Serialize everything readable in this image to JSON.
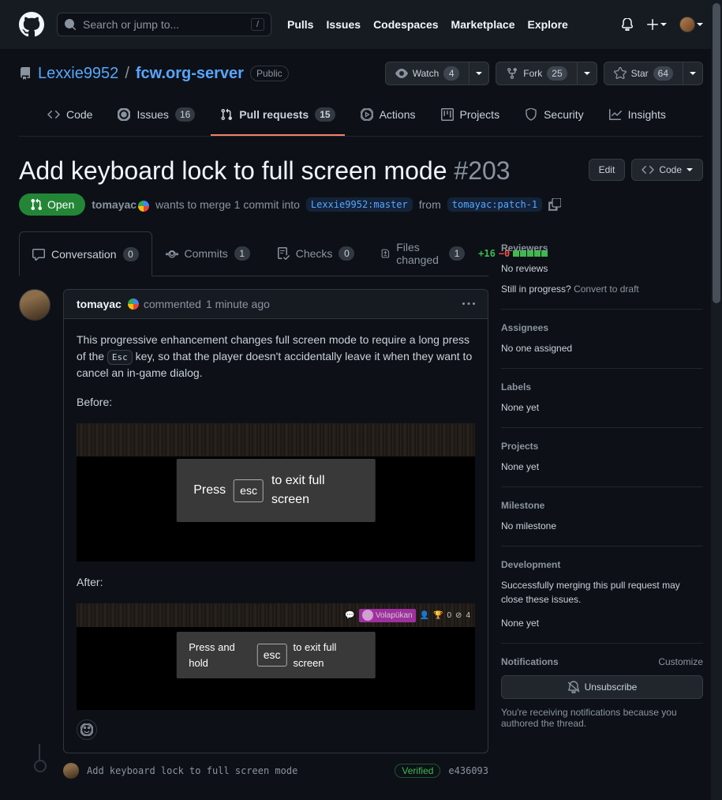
{
  "topbar": {
    "search_placeholder": "Search or jump to...",
    "slash": "/",
    "nav": {
      "pulls": "Pulls",
      "issues": "Issues",
      "codespaces": "Codespaces",
      "marketplace": "Marketplace",
      "explore": "Explore"
    }
  },
  "repo": {
    "owner": "Lexxie9952",
    "name": "fcw.org-server",
    "visibility": "Public",
    "watch": {
      "label": "Watch",
      "count": "4"
    },
    "fork": {
      "label": "Fork",
      "count": "25"
    },
    "star": {
      "label": "Star",
      "count": "64"
    }
  },
  "tabs": {
    "code": "Code",
    "issues": "Issues",
    "issues_count": "16",
    "prs": "Pull requests",
    "prs_count": "15",
    "actions": "Actions",
    "projects": "Projects",
    "security": "Security",
    "insights": "Insights"
  },
  "pr": {
    "title": "Add keyboard lock to full screen mode",
    "number": "#203",
    "edit": "Edit",
    "code_btn": "Code",
    "state": "Open",
    "author": "tomayac",
    "merge_text_1": "wants to merge 1 commit into",
    "base_branch": "Lexxie9952:master",
    "from": "from",
    "head_branch": "tomayac:patch-1"
  },
  "inner_tabs": {
    "conv": "Conversation",
    "conv_count": "0",
    "commits": "Commits",
    "commits_count": "1",
    "checks": "Checks",
    "checks_count": "0",
    "files": "Files changed",
    "files_count": "1"
  },
  "diff": {
    "add": "+16",
    "del": "−0"
  },
  "comment": {
    "author": "tomayac",
    "time_prefix": "commented",
    "time": "1 minute ago",
    "p1a": "This progressive enhancement changes full screen mode to require a long press of the ",
    "p1kbd": "Esc",
    "p1b": " key, so that the player doesn't accidentally leave it when they want to cancel an in-game dialog.",
    "before": "Before:",
    "after": "After:",
    "toast1_a": "Press",
    "toast1_k": "esc",
    "toast1_b": "to exit full screen",
    "toast2_a": "Press and hold",
    "toast2_k": "esc",
    "toast2_b": "to exit full screen",
    "vola": "Volapükan",
    "bar2_a": "0",
    "bar2_b": "4"
  },
  "commit": {
    "msg": "Add keyboard lock to full screen mode",
    "verified": "Verified",
    "sha": "e436093"
  },
  "sidebar": {
    "reviewers": {
      "title": "Reviewers",
      "text": "No reviews",
      "q": "Still in progress?",
      "link": "Convert to draft"
    },
    "assignees": {
      "title": "Assignees",
      "text": "No one assigned"
    },
    "labels": {
      "title": "Labels",
      "text": "None yet"
    },
    "projects": {
      "title": "Projects",
      "text": "None yet"
    },
    "milestone": {
      "title": "Milestone",
      "text": "No milestone"
    },
    "dev": {
      "title": "Development",
      "text": "Successfully merging this pull request may close these issues.",
      "none": "None yet"
    },
    "notif": {
      "title": "Notifications",
      "customize": "Customize",
      "unsub": "Unsubscribe",
      "reason": "You're receiving notifications because you authored the thread."
    }
  }
}
